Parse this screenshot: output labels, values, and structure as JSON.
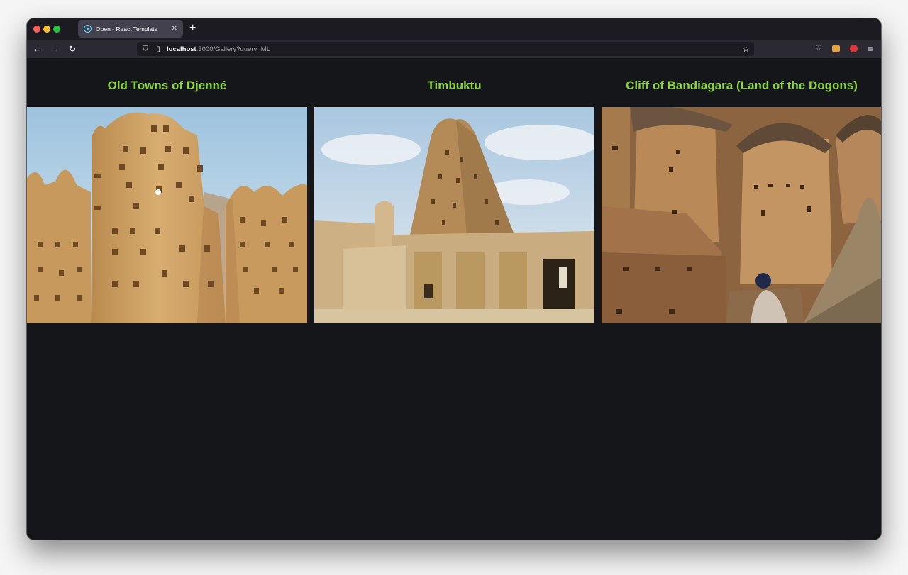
{
  "browser": {
    "tab": {
      "title": "Open - React Template",
      "favicon": "react-icon"
    },
    "url": {
      "host": "localhost",
      "path": ":3000/Gallery?query=ML"
    }
  },
  "gallery": {
    "items": [
      {
        "title": "Old Towns of Djenné"
      },
      {
        "title": "Timbuktu"
      },
      {
        "title": "Cliff of Bandiagara (Land of the Dogons)"
      }
    ]
  },
  "colors": {
    "title_green": "#8bd63a",
    "background": "#151619"
  }
}
